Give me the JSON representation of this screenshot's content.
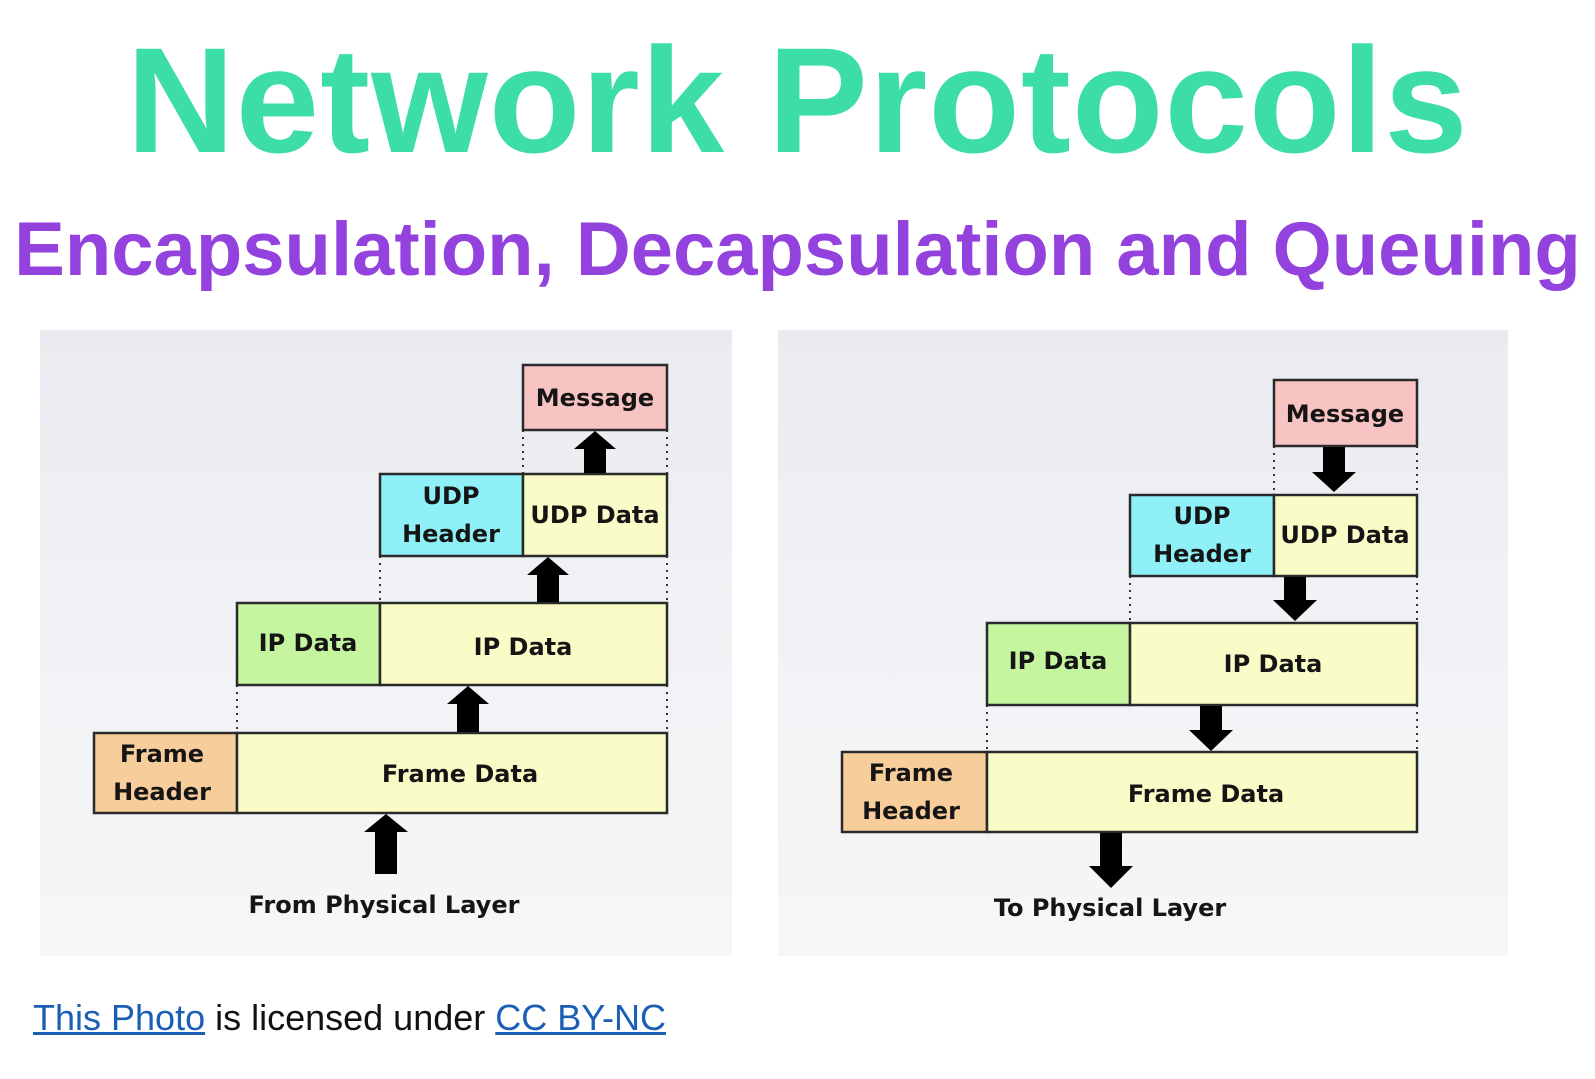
{
  "title": "Network Protocols",
  "subtitle": "Encapsulation, Decapsulation and Queuing",
  "colors": {
    "title": "#3ddda8",
    "subtitle": "#9342de",
    "message": "#f8c3c3",
    "udp_header": "#8ff0f8",
    "ip_header": "#c5f59e",
    "frame_header": "#f7cd9c",
    "data": "#fafcc8",
    "link": "#1a5fb4"
  },
  "left_diagram": {
    "message": "Message",
    "udp_header_line1": "UDP",
    "udp_header_line2": "Header",
    "udp_data": "UDP Data",
    "ip_header": "IP Data",
    "ip_data": "IP Data",
    "frame_header_line1": "Frame",
    "frame_header_line2": "Header",
    "frame_data": "Frame Data",
    "caption": "From Physical Layer"
  },
  "right_diagram": {
    "message": "Message",
    "udp_header_line1": "UDP",
    "udp_header_line2": "Header",
    "udp_data": "UDP Data",
    "ip_header": "IP Data",
    "ip_data": "IP Data",
    "frame_header_line1": "Frame",
    "frame_header_line2": "Header",
    "frame_data": "Frame Data",
    "caption": "To Physical Layer"
  },
  "footer": {
    "link1": "This Photo",
    "middle": " is licensed under ",
    "link2": "CC BY-NC"
  }
}
